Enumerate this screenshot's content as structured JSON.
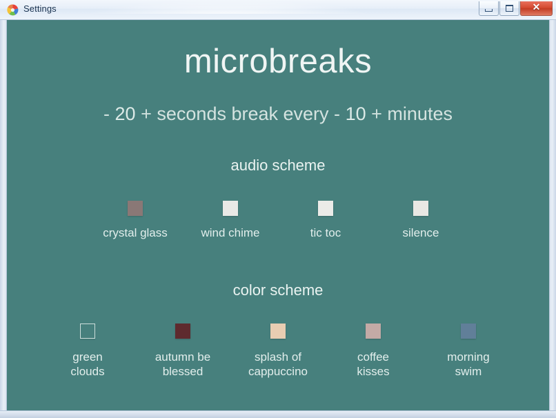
{
  "window": {
    "title": "Settings",
    "icon": "app-swirl-icon",
    "controls": {
      "minimize": "–",
      "maximize": "☐",
      "close": "✕"
    }
  },
  "app": {
    "title": "microbreaks",
    "background_color": "#47807d",
    "subtitle": {
      "break_decrement": "-",
      "break_seconds": "20",
      "break_increment": "+",
      "middle_text": "seconds break every",
      "interval_decrement": "-",
      "interval_minutes": "10",
      "interval_increment": "+",
      "trailing_text": "minutes"
    },
    "audio_section": {
      "heading": "audio scheme",
      "items": [
        {
          "label": "crystal glass",
          "color": "#8a7876",
          "selected": true
        },
        {
          "label": "wind chime",
          "color": "#e9e9e6",
          "selected": false
        },
        {
          "label": "tic toc",
          "color": "#ebebe8",
          "selected": false
        },
        {
          "label": "silence",
          "color": "#e9e8e4",
          "selected": false
        }
      ]
    },
    "color_section": {
      "heading": "color scheme",
      "items": [
        {
          "label": "green\nclouds",
          "color": "#47807d",
          "selected": true
        },
        {
          "label": "autumn be\nblessed",
          "color": "#5e2a2e",
          "selected": false
        },
        {
          "label": "splash of\ncappuccino",
          "color": "#e9cdb2",
          "selected": false
        },
        {
          "label": "coffee\nkisses",
          "color": "#c3aaa6",
          "selected": false
        },
        {
          "label": "morning\nswim",
          "color": "#617f99",
          "selected": false
        }
      ]
    }
  }
}
